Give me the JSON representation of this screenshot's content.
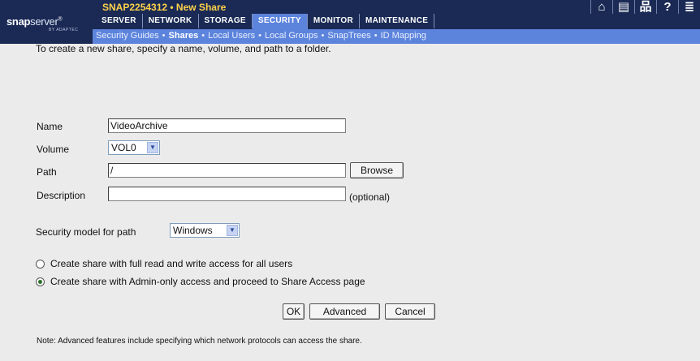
{
  "logo": {
    "bold": "snap",
    "light": "server",
    "tm": "®",
    "sub": "BY ADAPTEC"
  },
  "title": "SNAP2254312 • New Share",
  "header_icons": [
    {
      "name": "home-icon",
      "glyph": "⌂"
    },
    {
      "name": "server-icon",
      "glyph": "▤"
    },
    {
      "name": "network-map-icon",
      "glyph": "品"
    },
    {
      "name": "help-icon",
      "glyph": "?"
    },
    {
      "name": "storage-icon",
      "glyph": "≣"
    }
  ],
  "nav": [
    {
      "label": "SERVER",
      "active": false
    },
    {
      "label": "NETWORK",
      "active": false
    },
    {
      "label": "STORAGE",
      "active": false
    },
    {
      "label": "SECURITY",
      "active": true
    },
    {
      "label": "MONITOR",
      "active": false
    },
    {
      "label": "MAINTENANCE",
      "active": false
    }
  ],
  "subnav": [
    {
      "label": "Security Guides",
      "active": false
    },
    {
      "label": "Shares",
      "active": true
    },
    {
      "label": "Local Users",
      "active": false
    },
    {
      "label": "Local Groups",
      "active": false
    },
    {
      "label": "SnapTrees",
      "active": false
    },
    {
      "label": "ID Mapping",
      "active": false
    }
  ],
  "subnav_separator": "•",
  "form": {
    "intro": "To create a new share, specify a name, volume, and path to a folder.",
    "name_label": "Name",
    "name_value": "VideoArchive",
    "volume_label": "Volume",
    "volume_value": "VOL0",
    "path_label": "Path",
    "path_value": "/",
    "browse_label": "Browse",
    "description_label": "Description",
    "description_value": "",
    "optional_label": "(optional)",
    "security_label": "Security model for path",
    "security_value": "Windows",
    "radio_full": "Create share with full read and write access for all users",
    "radio_admin": "Create share with Admin-only access and proceed to Share Access page",
    "radio_selected": "admin",
    "ok_label": "OK",
    "advanced_label": "Advanced",
    "cancel_label": "Cancel",
    "note": "Note: Advanced features include specifying which network protocols can access the share."
  },
  "colors": {
    "header_dark": "#1a2a55",
    "accent_blue": "#5d84dc",
    "title_yellow": "#ffd24a",
    "content_bg": "#ebebeb"
  }
}
